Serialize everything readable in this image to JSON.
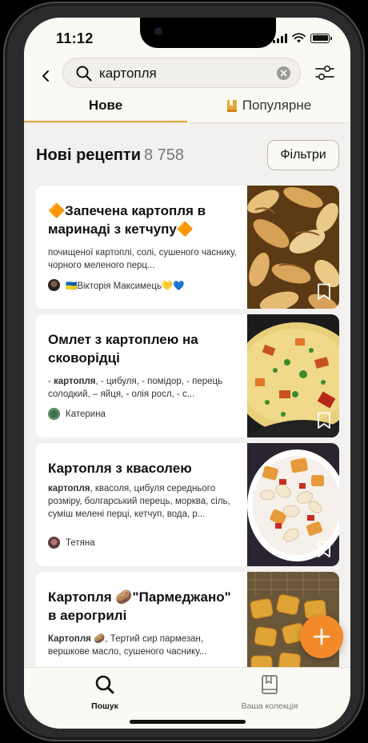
{
  "status_bar": {
    "time": "11:12"
  },
  "search": {
    "query": "картопля"
  },
  "tabs": [
    {
      "label": "Нове",
      "active": true
    },
    {
      "label": "Популярне",
      "active": false
    }
  ],
  "section": {
    "title": "Нові рецепти",
    "count": "8 758",
    "filters_label": "Фільтри"
  },
  "recipes": [
    {
      "title": "🔶Запечена картопля в маринаді з кетчупу🔶",
      "ingredients": "почищеної картоплі, солі, сушеного часнику,  чорного меленого перц...",
      "author": "🇺🇦Вікторія Максимець💛💙"
    },
    {
      "title": "Омлет з картоплею на сковорідці",
      "ingredients_bold": "картопля",
      "ingredients_prefix": " - ",
      "ingredients_rest": ",  - цибуля,  - помідор,  - перець солодкий, – яйця,  - олія росл,  - с...",
      "author": "Катерина"
    },
    {
      "title": "Картопля з квасолею",
      "ingredients_bold": "картопля",
      "ingredients_rest": ", квасоля, цибуля середнього розміру, болгарський перець, морква, сіль, суміш мелені перці,  кетчуп, вода, р...",
      "author": "Тетяна"
    },
    {
      "title": "Картопля 🥔\"Пармеджано\" в аерогрилі",
      "ingredients_bold": "Картопля 🥔",
      "ingredients_rest": ",  Тертий сир пармезан, вершкове масло, сушеного часнику..."
    }
  ],
  "bottom_nav": [
    {
      "label": "Пошук",
      "active": true
    },
    {
      "label": "Ваша колекція",
      "active": false
    }
  ],
  "colors": {
    "accent": "#e7a53a",
    "fab": "#f28a2a",
    "background": "#f2f1ef"
  }
}
